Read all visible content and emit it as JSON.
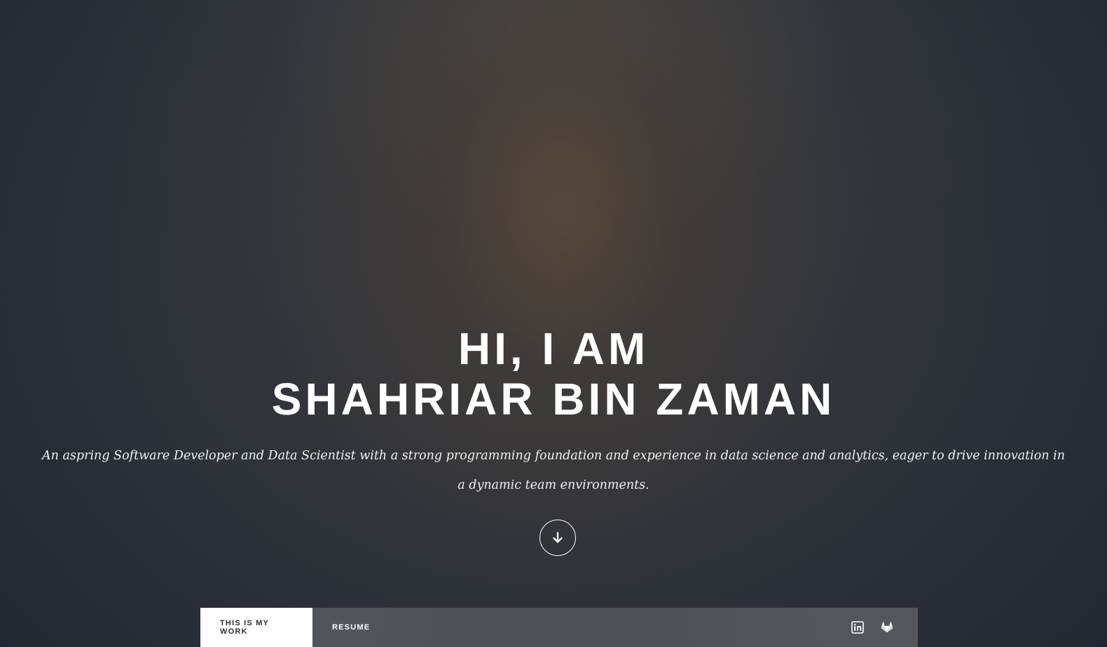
{
  "hero": {
    "headline_line1": "HI, I AM",
    "headline_line2": "SHAHRIAR BIN ZAMAN",
    "tagline": "An aspring Software Developer and Data Scientist with a strong programming foundation and experience in data science and analytics, eager to drive innovation in a dynamic team environments.",
    "scroll_icon": "arrow-down-icon"
  },
  "nav": {
    "tabs": [
      {
        "label": "THIS IS MY WORK",
        "active": true
      },
      {
        "label": "RESUME",
        "active": false
      }
    ],
    "icons": [
      "linkedin-icon",
      "gitlab-icon"
    ]
  },
  "colors": {
    "text": "#ffffff",
    "active_tab_bg": "#ffffff",
    "active_tab_text": "#2b2f36",
    "navbar_bg": "#55585e"
  }
}
